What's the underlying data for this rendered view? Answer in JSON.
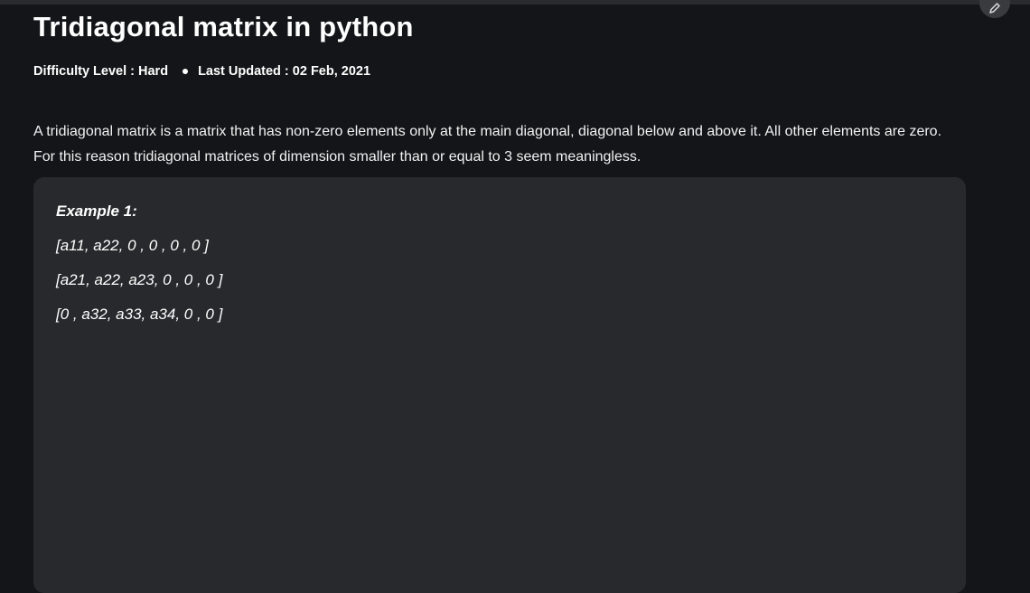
{
  "article": {
    "title": "Tridiagonal matrix in python",
    "difficulty": "Difficulty Level : Hard",
    "last_updated": "Last Updated : 02 Feb, 2021",
    "intro": "A tridiagonal matrix is a matrix that has non-zero elements only at the main diagonal, diagonal below and above it. All other elements are zero. For this reason tridiagonal matrices of dimension smaller than or equal to 3 seem meaningless."
  },
  "example": {
    "title": "Example 1:",
    "rows": [
      "[a11, a22, 0 , 0 , 0 , 0 ]",
      "[a21, a22, a23, 0 , 0 , 0 ]",
      "[0 , a32, a33, a34, 0 , 0 ]"
    ]
  },
  "icons": {
    "edit": "pencil-icon"
  }
}
